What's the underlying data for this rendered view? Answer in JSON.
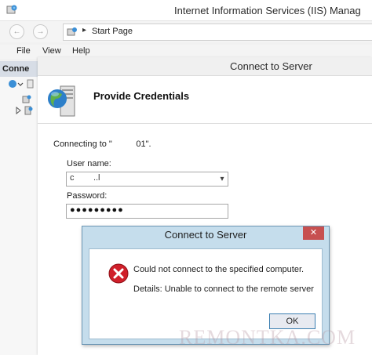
{
  "iis": {
    "title": "Internet Information Services (IIS) Manag",
    "address": {
      "separator": "▸",
      "text": "Start Page"
    },
    "menu": [
      "File",
      "View",
      "Help"
    ],
    "connections_header": "Conne",
    "nav": {
      "back_glyph": "←",
      "forward_glyph": "→"
    }
  },
  "wizard": {
    "title": "Connect to Server",
    "heading": "Provide Credentials",
    "connecting_text": "Connecting to \"          01\".",
    "username_label": "User name:",
    "username_value": "c        ..l",
    "combo_arrow": "▾",
    "password_label": "Password:",
    "password_value": "●●●●●●●●●"
  },
  "error_dialog": {
    "title": "Connect to Server",
    "close_glyph": "✕",
    "message": "Could not connect to the specified computer.",
    "details": "Details: Unable to connect to the remote server",
    "ok_label": "OK"
  },
  "watermark": "REMONTKA.COM",
  "icons": {
    "app": "iis-app-icon",
    "address": "iis-address-icon",
    "server": "server-globe-icon",
    "error": "error-x-icon"
  },
  "colors": {
    "error_red": "#d01f2a",
    "dialog_frame": "#c5ddec",
    "close_button": "#c75050",
    "ok_border": "#3c7fb1"
  }
}
